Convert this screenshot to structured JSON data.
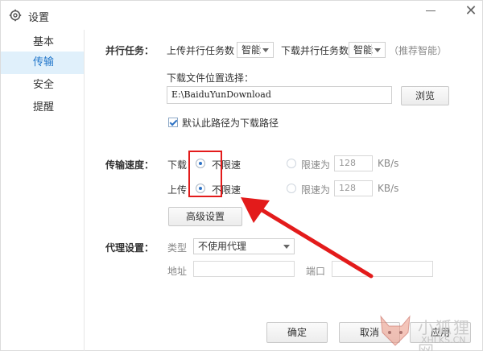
{
  "window": {
    "title": "设置"
  },
  "sidebar": {
    "items": [
      {
        "label": "基本",
        "active": false
      },
      {
        "label": "传输",
        "active": true
      },
      {
        "label": "安全",
        "active": false
      },
      {
        "label": "提醒",
        "active": false
      }
    ]
  },
  "parallel": {
    "section_label": "并行任务：",
    "upload_label": "上传并行任务数",
    "upload_value": "智能",
    "download_label": "下载并行任务数",
    "download_value": "智能",
    "hint": "（推荐智能）"
  },
  "download_location": {
    "label": "下载文件位置选择：",
    "path": "E:\\BaiduYunDownload",
    "browse_button": "浏览",
    "default_checkbox_label": "默认此路径为下载路径",
    "default_checked": true
  },
  "speed": {
    "section_label": "传输速度：",
    "download_label": "下载",
    "upload_label": "上传",
    "unlimited_label": "不限速",
    "limit_label": "限速为",
    "download_limit_value": "128",
    "upload_limit_value": "128",
    "unit": "KB/s",
    "download_unlimited_selected": true,
    "upload_unlimited_selected": true,
    "advanced_button": "高级设置"
  },
  "proxy": {
    "section_label": "代理设置：",
    "type_label": "类型",
    "type_value": "不使用代理",
    "address_label": "地址",
    "address_value": "",
    "port_label": "端口",
    "port_value": ""
  },
  "footer": {
    "ok_button": "确定",
    "cancel_button": "取消",
    "apply_button": "应用"
  },
  "watermark": {
    "cn_text": "小狐狸网",
    "site_text": "XHLKS.CN"
  },
  "colors": {
    "accent": "#2d72c5",
    "sidebar_active_bg": "#e0f0fb",
    "annotation_red": "#e31b1b"
  }
}
